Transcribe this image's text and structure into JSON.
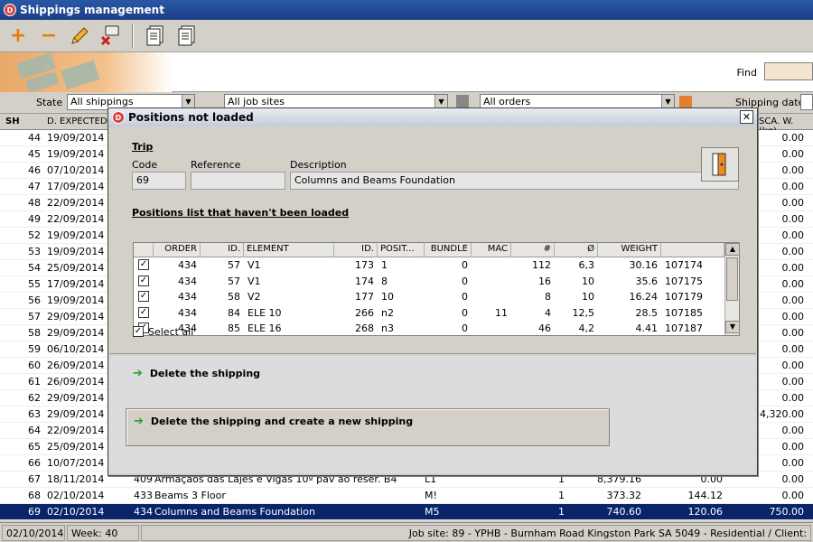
{
  "window": {
    "title": "Shippings management"
  },
  "toolbar": {
    "add": "+",
    "remove": "−"
  },
  "find": {
    "label": "Find",
    "value": ""
  },
  "filters": {
    "state_label": "State",
    "state_value": "All shippings",
    "jobsite_value": "All job sites",
    "orders_value": "All orders",
    "shipping_date_label": "Shipping date"
  },
  "grid": {
    "col_sh": "SH",
    "col_expected": "D. EXPECTED",
    "col_scaw": "SCA. W. (kg)",
    "rows": [
      {
        "sh": "44",
        "date": "19/09/2014",
        "w": "0.00"
      },
      {
        "sh": "45",
        "date": "19/09/2014",
        "w": "0.00"
      },
      {
        "sh": "46",
        "date": "07/10/2014",
        "w": "0.00"
      },
      {
        "sh": "47",
        "date": "17/09/2014",
        "w": "0.00"
      },
      {
        "sh": "48",
        "date": "22/09/2014",
        "w": "0.00"
      },
      {
        "sh": "49",
        "date": "22/09/2014",
        "w": "0.00"
      },
      {
        "sh": "52",
        "date": "19/09/2014",
        "w": "0.00"
      },
      {
        "sh": "53",
        "date": "19/09/2014",
        "w": "0.00"
      },
      {
        "sh": "54",
        "date": "25/09/2014",
        "w": "0.00"
      },
      {
        "sh": "55",
        "date": "17/09/2014",
        "w": "0.00"
      },
      {
        "sh": "56",
        "date": "19/09/2014",
        "w": "0.00"
      },
      {
        "sh": "57",
        "date": "29/09/2014",
        "w": "0.00"
      },
      {
        "sh": "58",
        "date": "29/09/2014",
        "w": "0.00"
      },
      {
        "sh": "59",
        "date": "06/10/2014",
        "w": "0.00"
      },
      {
        "sh": "60",
        "date": "26/09/2014",
        "w": "0.00"
      },
      {
        "sh": "61",
        "date": "26/09/2014",
        "w": "0.00"
      },
      {
        "sh": "62",
        "date": "29/09/2014",
        "w": "0.00"
      },
      {
        "sh": "63",
        "date": "29/09/2014",
        "w": "4,320.00"
      },
      {
        "sh": "64",
        "date": "22/09/2014",
        "w": "0.00"
      },
      {
        "sh": "65",
        "date": "25/09/2014",
        "w": "0.00"
      },
      {
        "sh": "66",
        "date": "10/07/2014",
        "w": "0.00"
      }
    ],
    "row67": {
      "sh": "67",
      "date": "18/11/2014",
      "order": "409",
      "desc": "Armaçãos das Lajes e Vigas 10º pav ao reser. B4",
      "pos": "L1",
      "n": "1",
      "a": "8,379.16",
      "b": "0.00",
      "w": "0.00"
    },
    "row68": {
      "sh": "68",
      "date": "02/10/2014",
      "order": "433",
      "desc": "Beams 3 Floor",
      "pos": "M!",
      "n": "1",
      "a": "373.32",
      "b": "144.12",
      "w": "0.00"
    },
    "row69": {
      "sh": "69",
      "date": "02/10/2014",
      "order": "434",
      "desc": "Columns and Beams Foundation",
      "pos": "M5",
      "n": "1",
      "a": "740.60",
      "b": "120.06",
      "w": "750.00"
    }
  },
  "status": {
    "date": "02/10/2014",
    "week": "Week: 40",
    "jobsite": "Job site: 89 - YPHB - Burnham Road Kingston Park SA 5049 - Residential / Client:"
  },
  "dialog": {
    "title": "Positions not loaded",
    "trip_label": "Trip",
    "code_label": "Code",
    "code_value": "69",
    "reference_label": "Reference",
    "reference_value": "",
    "description_label": "Description",
    "description_value": "Columns and Beams Foundation",
    "list_title": "Positions list that haven't been loaded",
    "columns": [
      "ORDER",
      "ID.",
      "ELEMENT",
      "ID.",
      "POSIT...",
      "BUNDLE",
      "MAC",
      "#",
      "Ø",
      "WEIGHT",
      ""
    ],
    "rows": [
      {
        "order": "434",
        "id": "57",
        "element": "V1",
        "id2": "173",
        "posit": "1",
        "bundle": "0",
        "mac": "",
        "n": "112",
        "d": "6,3",
        "weight": "30.16",
        "code": "107174"
      },
      {
        "order": "434",
        "id": "57",
        "element": "V1",
        "id2": "174",
        "posit": "8",
        "bundle": "0",
        "mac": "",
        "n": "16",
        "d": "10",
        "weight": "35.6",
        "code": "107175"
      },
      {
        "order": "434",
        "id": "58",
        "element": "V2",
        "id2": "177",
        "posit": "10",
        "bundle": "0",
        "mac": "",
        "n": "8",
        "d": "10",
        "weight": "16.24",
        "code": "107179"
      },
      {
        "order": "434",
        "id": "84",
        "element": "ELE 10",
        "id2": "266",
        "posit": "n2",
        "bundle": "0",
        "mac": "11",
        "n": "4",
        "d": "12,5",
        "weight": "28.5",
        "code": "107185"
      },
      {
        "order": "434",
        "id": "85",
        "element": "ELE 16",
        "id2": "268",
        "posit": "n3",
        "bundle": "0",
        "mac": "",
        "n": "46",
        "d": "4,2",
        "weight": "4.41",
        "code": "107187"
      }
    ],
    "select_all_label": "Select all",
    "delete_label": "Delete the shipping",
    "delete_create_label": "Delete the shipping and create a new shipping"
  }
}
